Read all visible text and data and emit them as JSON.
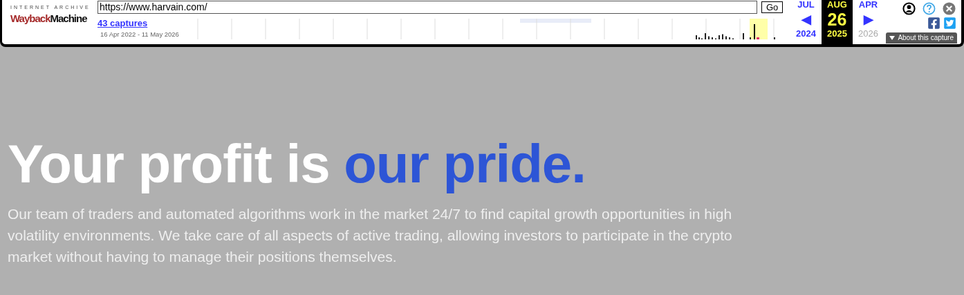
{
  "toolbar": {
    "logo_top": "INTERNET ARCHIVE",
    "logo_wordmark_1": "Wayback",
    "logo_wordmark_2": "Machine",
    "url": "https://www.harvain.com/",
    "go_button": "Go",
    "captures_link": "43 captures",
    "date_range": "16 Apr 2022 - 11 May 2026",
    "calendar": [
      {
        "month": "JUL",
        "arrow": "◀",
        "year": "2024",
        "selected": false,
        "disabled": false
      },
      {
        "month": "AUG",
        "day": "26",
        "year": "2025",
        "selected": true,
        "disabled": false
      },
      {
        "month": "APR",
        "arrow": "▶",
        "year": "2026",
        "selected": false,
        "disabled": true
      }
    ],
    "about_button": "About this capture"
  },
  "hero": {
    "title_start": "Your profit is ",
    "title_highlight": "our pride.",
    "body": "Our team of traders and automated algorithms work in the market 24/7 to find capital growth opportunities in high volatility environments. We take care of all aspects of active trading, allowing investors to participate in the crypto market without having to manage their positions themselves."
  }
}
